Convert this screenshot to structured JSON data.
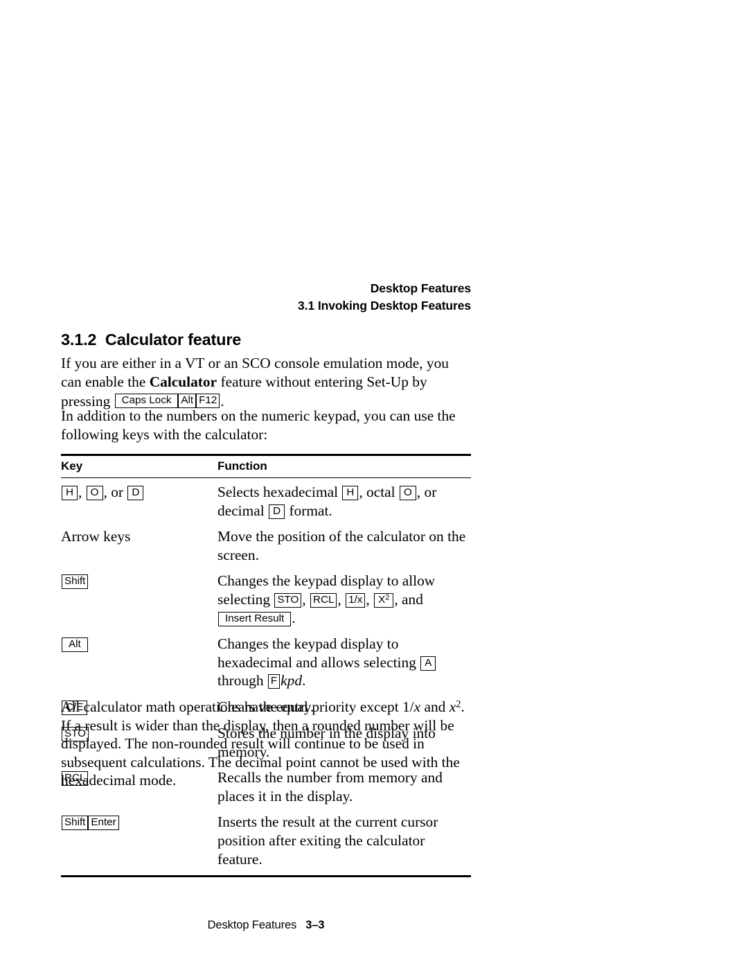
{
  "running_head": {
    "line1": "Desktop Features",
    "line2": "3.1 Invoking Desktop Features"
  },
  "section": {
    "number": "3.1.2",
    "title": "Calculator feature",
    "heading_full": "3.1.2  Calculator feature"
  },
  "paragraphs": {
    "intro_part1": "If you are either in a VT or an SCO console emulation mode, you can enable the ",
    "intro_bold": "Calculator",
    "intro_part2": " feature without entering Set-Up by pressing ",
    "intro_key_caps_lock": "Caps Lock",
    "intro_key_alt": "Alt",
    "intro_key_f12": "F12",
    "intro_end": ".",
    "second": "In addition to the numbers on the numeric keypad, you can use the following keys with the calculator:",
    "closing_part1": "All calculator math operations have equal priority except 1/",
    "closing_var1": "x",
    "closing_part2": " and ",
    "closing_var2": "x",
    "closing_sup": "2",
    "closing_part3": ". If a result is wider than the display, then a rounded number will be displayed. The non-rounded result will continue to be used in subsequent calculations. The decimal point cannot be used with the hexadecimal mode."
  },
  "table": {
    "headers": {
      "key": "Key",
      "function": "Function"
    },
    "rows": [
      {
        "key_keys": [
          "H",
          "O",
          "D"
        ],
        "key_sep1": ", ",
        "key_sep2": ", or ",
        "fn_part1": "Selects hexadecimal ",
        "fn_key1": "H",
        "fn_part2": ", octal ",
        "fn_key2": "O",
        "fn_part3": ", or decimal ",
        "fn_key3": "D",
        "fn_part4": " format."
      },
      {
        "key_text": "Arrow keys",
        "fn_part1": "Move the position of the calculator on the screen."
      },
      {
        "key_key": "Shift",
        "fn_part1": "Changes the keypad display to allow selecting ",
        "fn_key1": "STO",
        "fn_part2": ", ",
        "fn_key2": "RCL",
        "fn_part3": ", ",
        "fn_key3": "1/x",
        "fn_part4": ", ",
        "fn_key4": "X",
        "fn_key4_sup": "2",
        "fn_part5": ", and ",
        "fn_key5": "Insert Result",
        "fn_part6": "."
      },
      {
        "key_key": "Alt",
        "fn_part1": "Changes the keypad display to hexadecimal and allows selecting ",
        "fn_key1": "A",
        "fn_part2": " through ",
        "fn_key2": "F",
        "fn_italic": "kpd",
        "fn_part3": "."
      },
      {
        "key_key": "C/E",
        "fn_part1": "Clears the entry."
      },
      {
        "key_key": "STO",
        "fn_part1": "Stores the number in the display into memory."
      },
      {
        "key_key": "RCL",
        "fn_part1": "Recalls the number from memory and places it in the display."
      },
      {
        "key_keys_run": [
          "Shift",
          "Enter"
        ],
        "fn_part1": "Inserts the result at the current cursor position after exiting the calculator feature."
      }
    ]
  },
  "footer": {
    "title": "Desktop Features",
    "page_number": "3–3"
  }
}
